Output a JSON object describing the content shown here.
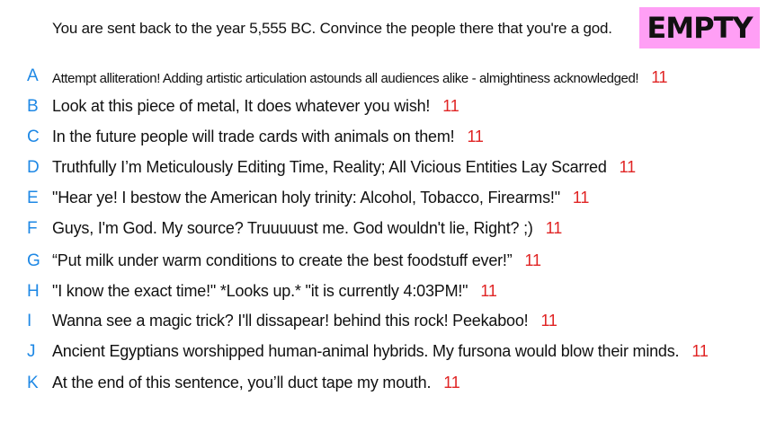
{
  "prompt": "You are sent back to the year 5,555 BC. Convince the people there that you're a god.",
  "badge": "EMPTY",
  "colors": {
    "letter": "#1e88e5",
    "score": "#e02424",
    "badge_bg": "#ff9ff5"
  },
  "answers": [
    {
      "letter": "A",
      "text": "Attempt alliteration! Adding artistic articulation astounds all audiences alike - almightiness acknowledged!",
      "score": "11"
    },
    {
      "letter": "B",
      "text": "Look at this piece of metal, It does whatever you wish!",
      "score": "11"
    },
    {
      "letter": "C",
      "text": "In the future people will trade cards with animals on them!",
      "score": "11"
    },
    {
      "letter": "D",
      "text": "Truthfully I’m Meticulously Editing Time, Reality; All Vicious Entities Lay Scarred",
      "score": "11"
    },
    {
      "letter": "E",
      "text": "\"Hear ye! I bestow the American holy trinity: Alcohol, Tobacco, Firearms!\"",
      "score": "11"
    },
    {
      "letter": "F",
      "text": "Guys, I'm God. My source? Truuuuust me. God wouldn't lie, Right? ;)",
      "score": "11"
    },
    {
      "letter": "G",
      "text": "“Put milk under warm conditions to create the best foodstuff ever!”",
      "score": "11"
    },
    {
      "letter": "H",
      "text": "\"I know the exact time!\" *Looks up.* \"it is currently 4:03PM!\"",
      "score": "11"
    },
    {
      "letter": "I",
      "text": "Wanna see a magic trick? I'll dissapear! behind this rock! Peekaboo!",
      "score": "11"
    },
    {
      "letter": "J",
      "text": "Ancient Egyptians worshipped human-animal hybrids. My fursona would blow their minds.",
      "score": "11"
    },
    {
      "letter": "K",
      "text": "At the end of this sentence, you’ll duct tape my mouth.",
      "score": "11"
    }
  ]
}
